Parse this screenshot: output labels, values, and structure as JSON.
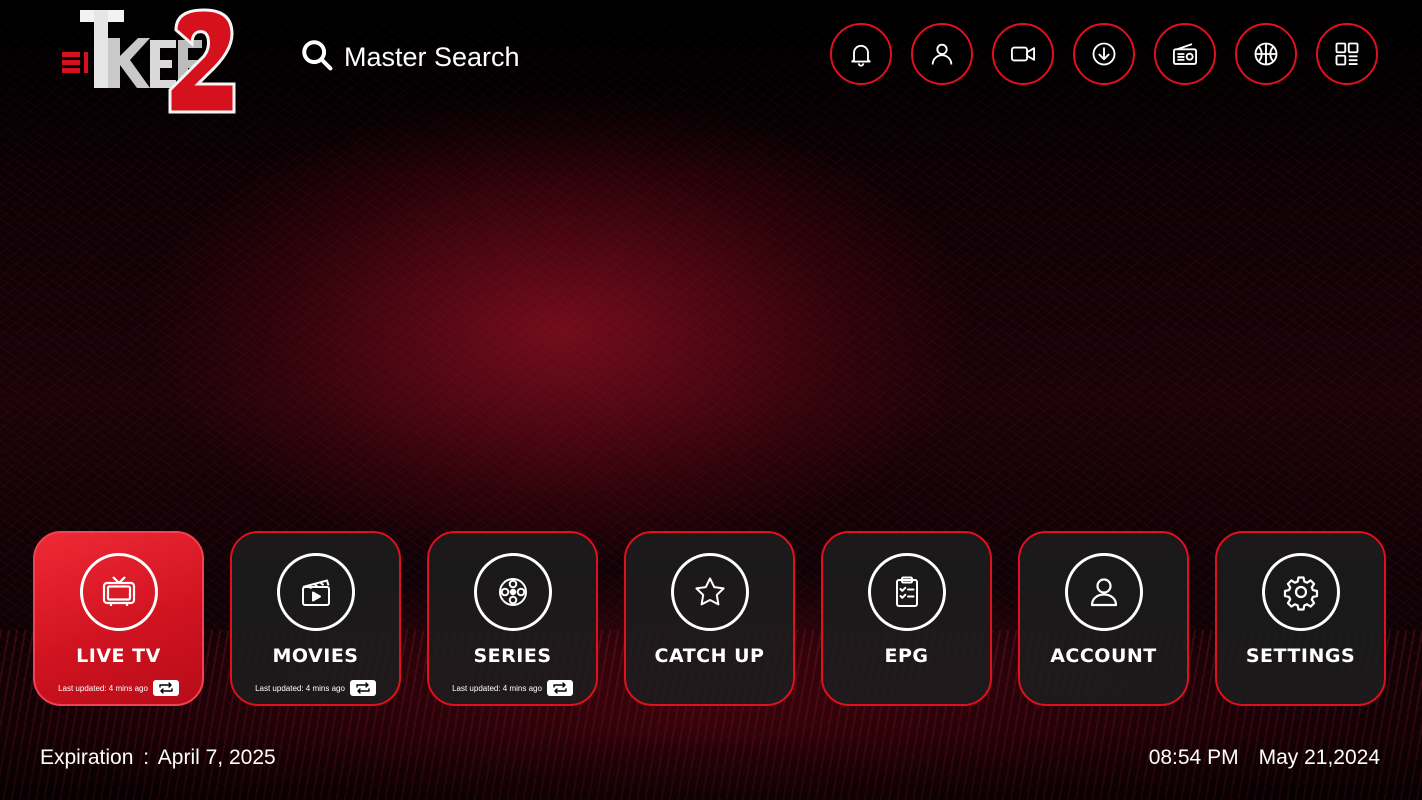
{
  "brand": {
    "logo_text": "TKEE2",
    "accent_color": "#e0101e"
  },
  "search": {
    "label": "Master Search",
    "icon": "search-icon"
  },
  "top_icons": [
    {
      "name": "notifications",
      "icon": "bell-icon"
    },
    {
      "name": "profile",
      "icon": "user-icon"
    },
    {
      "name": "recordings",
      "icon": "video-camera-icon"
    },
    {
      "name": "downloads",
      "icon": "download-icon"
    },
    {
      "name": "radio",
      "icon": "radio-icon"
    },
    {
      "name": "sports",
      "icon": "basketball-icon"
    },
    {
      "name": "apps",
      "icon": "grid-icon"
    }
  ],
  "tiles": [
    {
      "label": "LIVE TV",
      "icon": "tv-icon",
      "active": true,
      "updated": "Last updated: 4 mins ago"
    },
    {
      "label": "MOVIES",
      "icon": "clapperboard-icon",
      "active": false,
      "updated": "Last updated: 4 mins ago"
    },
    {
      "label": "SERIES",
      "icon": "film-reel-icon",
      "active": false,
      "updated": "Last updated: 4 mins ago"
    },
    {
      "label": "CATCH UP",
      "icon": "star-icon",
      "active": false
    },
    {
      "label": "EPG",
      "icon": "clipboard-icon",
      "active": false
    },
    {
      "label": "ACCOUNT",
      "icon": "user-icon",
      "active": false
    },
    {
      "label": "SETTINGS",
      "icon": "gear-icon",
      "active": false
    }
  ],
  "footer": {
    "expiration_label": "Expiration",
    "expiration_sep": ":",
    "expiration_date": "April 7, 2025",
    "time": "08:54 PM",
    "date": "May 21,2024"
  }
}
